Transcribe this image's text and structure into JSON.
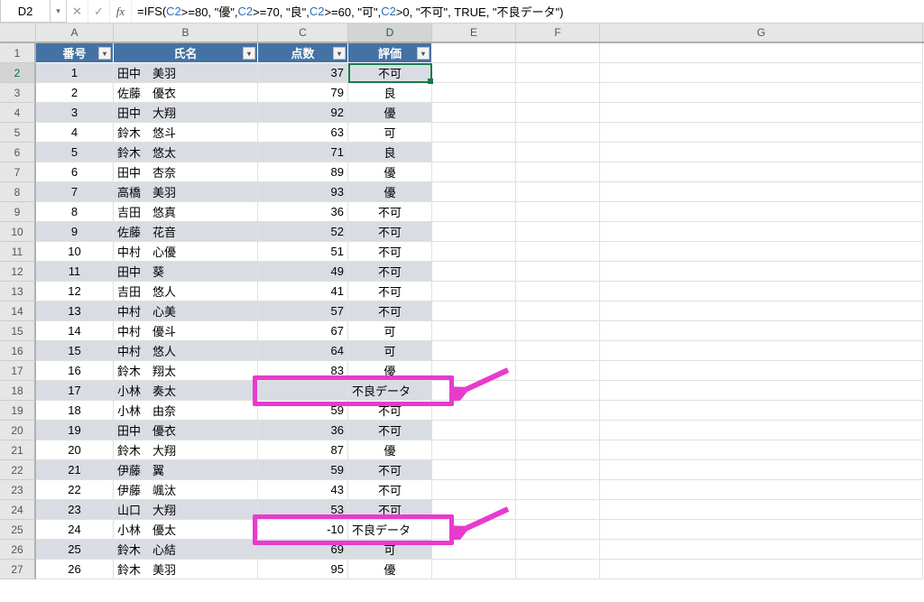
{
  "name_box": "D2",
  "formula": {
    "prefix": "=IFS(",
    "parts": [
      {
        "t": "ref",
        "v": "C2"
      },
      {
        "t": "txt",
        "v": ">=80, \"優\", "
      },
      {
        "t": "ref",
        "v": "C2"
      },
      {
        "t": "txt",
        "v": ">=70, \"良\", "
      },
      {
        "t": "ref",
        "v": "C2"
      },
      {
        "t": "txt",
        "v": ">=60, \"可\", "
      },
      {
        "t": "ref",
        "v": "C2"
      },
      {
        "t": "txt",
        "v": ">0, \"不可\", TRUE, \"不良データ\")"
      }
    ]
  },
  "columns": [
    "A",
    "B",
    "C",
    "D",
    "E",
    "F",
    "G"
  ],
  "header_row": {
    "a": "番号",
    "b": "氏名",
    "c": "点数",
    "d": "評価"
  },
  "rows": [
    {
      "n": "1",
      "name": "田中　美羽",
      "score": "37",
      "grade": "不可"
    },
    {
      "n": "2",
      "name": "佐藤　優衣",
      "score": "79",
      "grade": "良"
    },
    {
      "n": "3",
      "name": "田中　大翔",
      "score": "92",
      "grade": "優"
    },
    {
      "n": "4",
      "name": "鈴木　悠斗",
      "score": "63",
      "grade": "可"
    },
    {
      "n": "5",
      "name": "鈴木　悠太",
      "score": "71",
      "grade": "良"
    },
    {
      "n": "6",
      "name": "田中　杏奈",
      "score": "89",
      "grade": "優"
    },
    {
      "n": "7",
      "name": "高橋　美羽",
      "score": "93",
      "grade": "優"
    },
    {
      "n": "8",
      "name": "吉田　悠真",
      "score": "36",
      "grade": "不可"
    },
    {
      "n": "9",
      "name": "佐藤　花音",
      "score": "52",
      "grade": "不可"
    },
    {
      "n": "10",
      "name": "中村　心優",
      "score": "51",
      "grade": "不可"
    },
    {
      "n": "11",
      "name": "田中　葵",
      "score": "49",
      "grade": "不可"
    },
    {
      "n": "12",
      "name": "吉田　悠人",
      "score": "41",
      "grade": "不可"
    },
    {
      "n": "13",
      "name": "中村　心美",
      "score": "57",
      "grade": "不可"
    },
    {
      "n": "14",
      "name": "中村　優斗",
      "score": "67",
      "grade": "可"
    },
    {
      "n": "15",
      "name": "中村　悠人",
      "score": "64",
      "grade": "可"
    },
    {
      "n": "16",
      "name": "鈴木　翔太",
      "score": "83",
      "grade": "優"
    },
    {
      "n": "17",
      "name": "小林　奏太",
      "score": "",
      "grade": "不良データ"
    },
    {
      "n": "18",
      "name": "小林　由奈",
      "score": "59",
      "grade": "不可"
    },
    {
      "n": "19",
      "name": "田中　優衣",
      "score": "36",
      "grade": "不可"
    },
    {
      "n": "20",
      "name": "鈴木　大翔",
      "score": "87",
      "grade": "優"
    },
    {
      "n": "21",
      "name": "伊藤　翼",
      "score": "59",
      "grade": "不可"
    },
    {
      "n": "22",
      "name": "伊藤　颯汰",
      "score": "43",
      "grade": "不可"
    },
    {
      "n": "23",
      "name": "山口　大翔",
      "score": "53",
      "grade": "不可"
    },
    {
      "n": "24",
      "name": "小林　優太",
      "score": "-10",
      "grade": "不良データ"
    },
    {
      "n": "25",
      "name": "鈴木　心結",
      "score": "69",
      "grade": "可"
    },
    {
      "n": "26",
      "name": "鈴木　美羽",
      "score": "95",
      "grade": "優"
    }
  ],
  "icons": {
    "dropdown_caret": "▾",
    "cancel": "✕",
    "confirm": "✓"
  },
  "colors": {
    "hdr_bg": "#4472a4",
    "band": "#d9dde3",
    "active": "#1a7a44",
    "highlight": "#e83bce"
  }
}
